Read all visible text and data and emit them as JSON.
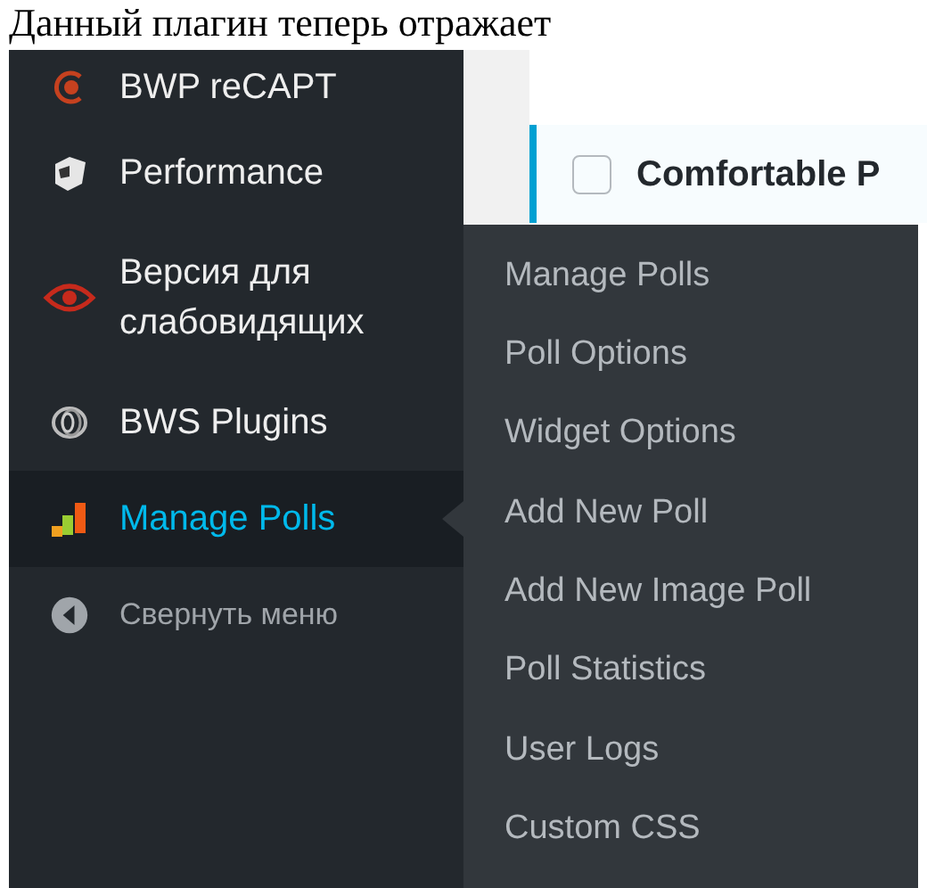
{
  "notice_text": "Данный плагин теперь отражает",
  "sidebar": {
    "items": [
      {
        "label": "BWP reCAPT",
        "selected": false
      },
      {
        "label": "Performance",
        "selected": false
      },
      {
        "label": "Версия для слабовидящих",
        "selected": false
      },
      {
        "label": "BWS Plugins",
        "selected": false
      },
      {
        "label": "Manage Polls",
        "selected": true
      }
    ],
    "collapse": {
      "label": "Свернуть меню"
    }
  },
  "content": {
    "row": {
      "checked": false,
      "title": "Comfortable P"
    }
  },
  "submenu": {
    "items": [
      {
        "label": "Manage Polls"
      },
      {
        "label": "Poll Options"
      },
      {
        "label": "Widget Options"
      },
      {
        "label": "Add New Poll"
      },
      {
        "label": "Add New Image Poll"
      },
      {
        "label": "Poll Statistics"
      },
      {
        "label": "User Logs"
      },
      {
        "label": "Custom CSS"
      }
    ]
  }
}
